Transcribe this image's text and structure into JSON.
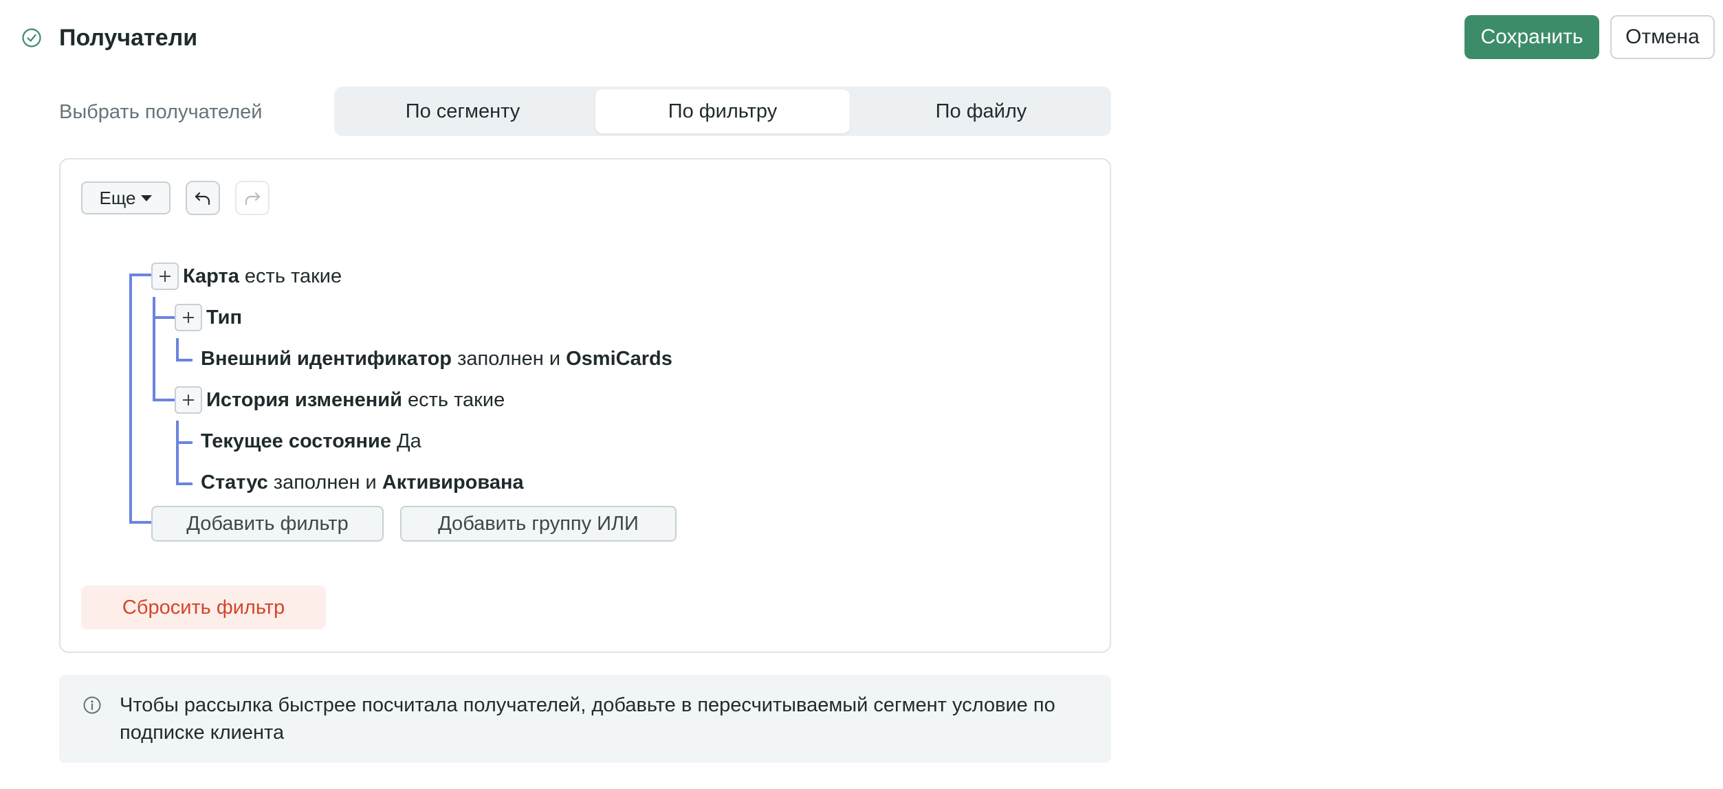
{
  "header": {
    "title": "Получатели",
    "save_label": "Сохранить",
    "cancel_label": "Отмена",
    "status_icon": "check-circle-icon",
    "accent_color": "#3d8c69"
  },
  "recipients": {
    "label": "Выбрать получателей",
    "tabs": [
      {
        "label": "По сегменту",
        "selected": false
      },
      {
        "label": "По фильтру",
        "selected": true
      },
      {
        "label": "По файлу",
        "selected": false
      }
    ]
  },
  "toolbar": {
    "more_label": "Еще",
    "undo_icon": "undo-icon",
    "redo_icon": "redo-icon"
  },
  "filter_tree": {
    "card": {
      "name": "Карта",
      "condition": "есть такие"
    },
    "type": {
      "name": "Тип"
    },
    "external_id": {
      "name": "Внешний идентификатор",
      "condition": "заполнен и",
      "value": "OsmiCards"
    },
    "history": {
      "name": "История изменений",
      "condition": "есть такие"
    },
    "current_state": {
      "name": "Текущее состояние",
      "value": "Да"
    },
    "status": {
      "name": "Статус",
      "condition": "заполнен и",
      "value": "Активирована"
    },
    "add_filter_label": "Добавить фильтр",
    "add_or_group_label": "Добавить группу ИЛИ",
    "line_color": "#6c84e0"
  },
  "reset_label": "Сбросить фильтр",
  "reset_color": "#d2462b",
  "info": {
    "icon": "info-icon",
    "text": "Чтобы рассылка быстрее посчитала получателей, добавьте в пересчитываемый сегмент условие по подписке клиента"
  }
}
